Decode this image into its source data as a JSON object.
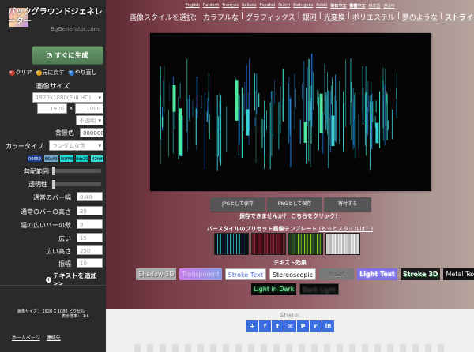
{
  "sidebar": {
    "app_title": "バックグラウンドジェネレーター",
    "app_url": "BgGenerator.com",
    "generate_label": "すぐに生成",
    "actions": [
      {
        "label": "クリア",
        "color": "#c0392b"
      },
      {
        "label": "元に戻す",
        "color": "#e2a21a"
      },
      {
        "label": "やり直し",
        "color": "#2f7dd1"
      }
    ],
    "image_size_label": "画像サイズ",
    "size_preset": "1920x1080(Full HD)",
    "width": "1920",
    "times": "x",
    "height": "1080",
    "opacity": "不透明",
    "bg_color_label": "背景色",
    "bg_color_value": "000000",
    "color_type_label": "カラータイプ",
    "color_type_value": "ランダムな色",
    "swatches": [
      {
        "hex": "00559",
        "bg": "#1a3c8c"
      },
      {
        "hex": "66a49",
        "bg": "#6aa4c8"
      },
      {
        "hex": "00FF8",
        "bg": "#22dddd"
      },
      {
        "hex": "0dc20",
        "bg": "#12d1c8"
      },
      {
        "hex": "42fdf",
        "bg": "#36e0d8"
      }
    ],
    "gradient_range_label": "勾配範囲",
    "transparency_label": "透明性",
    "normal_width_label": "通常のバー幅",
    "normal_width_value": "0.48",
    "normal_height_label": "通常のバーの高さ",
    "normal_height_value": "39",
    "wide_count_label": "幅の広いバーの数",
    "wide_count_value": "9",
    "wide_label": "広い",
    "wide_value": "15",
    "wide_height_label": "広い高さ",
    "wide_height_value": "250",
    "amplitude_label": "振幅",
    "amplitude_value": "10",
    "add_text_label": "テキストを追加>>",
    "image_size_info_label": "画像サイズ：",
    "image_size_info_value": "1920 X 1080 ピクセル",
    "display_ratio_label": "表示倍率：",
    "display_ratio_value": "1:6",
    "home_link": "ホームページ",
    "contact_link": "連絡先"
  },
  "header": {
    "languages": [
      "English",
      "Deutsch",
      "Français",
      "Italiano",
      "Español",
      "Dutch",
      "Português",
      "Polski",
      "简体中文",
      "繁體中文",
      "日本語",
      "한국어"
    ],
    "style_prompt": "画像スタイルを選択：",
    "styles": [
      "カラフルな",
      "グラフィックス",
      "銀河",
      "光変換",
      "ポリエステル",
      "夢のような",
      "ストライプ"
    ],
    "current_style": "ストライプ"
  },
  "buttons": {
    "save_jpg": "JPGとして保存",
    "save_png": "PNGとして保存",
    "donate": "寄付する"
  },
  "save_help": "保存できませんか？ こちらをクリック！",
  "presets": {
    "heading": "バースタイルのプリセット画像テンプレート",
    "more_link": "(もっとスタイルは？)"
  },
  "text_effects": {
    "heading": "テキスト効果",
    "items": [
      "Shadow 3D",
      "Transparent",
      "Stroke Text",
      "Stereoscopic",
      "Inset",
      "Light Text",
      "Stroke 3D",
      "Metal Text",
      "Light in Dark",
      "Dark Light"
    ]
  },
  "share": {
    "label": "Share:",
    "icons": [
      {
        "name": "share-plus-icon",
        "glyph": "+"
      },
      {
        "name": "facebook-icon",
        "glyph": "f"
      },
      {
        "name": "twitter-icon",
        "glyph": "t"
      },
      {
        "name": "email-icon",
        "glyph": "✉"
      },
      {
        "name": "pinterest-icon",
        "glyph": "P"
      },
      {
        "name": "reddit-icon",
        "glyph": "r"
      },
      {
        "name": "linkedin-icon",
        "glyph": "in"
      }
    ]
  },
  "colors": {
    "sidebar_bg": "#2a2a2a",
    "generate_green": "#5d8c61",
    "bar_cyan": "#3ad1d1",
    "bar_mint": "#4fe8a0",
    "share_blue": "#3d6ee0"
  }
}
